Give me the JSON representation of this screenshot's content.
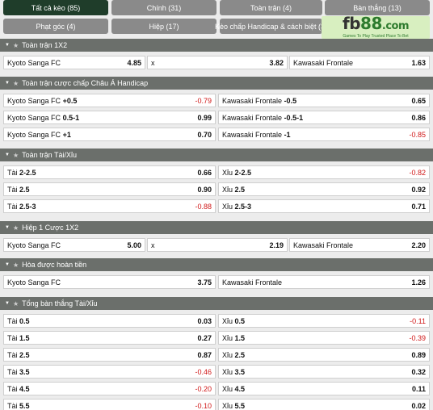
{
  "tabs": [
    {
      "label": "Tất cả kèo (85)",
      "active": true
    },
    {
      "label": "Chính (31)",
      "active": false
    },
    {
      "label": "Toàn trận (4)",
      "active": false
    },
    {
      "label": "Bàn thắng (13)",
      "active": false
    },
    {
      "label": "Phạt góc (4)",
      "active": false
    },
    {
      "label": "Hiệp (17)",
      "active": false
    },
    {
      "label": "Kèo chấp Handicap & cách biệt (3)",
      "active": false
    }
  ],
  "logo": {
    "brand_a": "fb",
    "brand_b": "88",
    "brand_c": ".com",
    "tagline": "Games To Play  Trusted Place To Bet"
  },
  "sections": [
    {
      "title": "Toàn trận 1X2",
      "layout": "three",
      "rows": [
        [
          {
            "name": "Kyoto Sanga FC",
            "odd": "4.85"
          },
          {
            "name": "x",
            "odd": "3.82"
          },
          {
            "name": "Kawasaki Frontale",
            "odd": "1.63"
          }
        ]
      ]
    },
    {
      "title": "Toàn trận cược chấp Châu Á Handicap",
      "layout": "two",
      "rows": [
        [
          {
            "name": "Kyoto Sanga FC",
            "line": "+0.5",
            "odd": "-0.79"
          },
          {
            "name": "Kawasaki Frontale",
            "line": "-0.5",
            "odd": "0.65"
          }
        ],
        [
          {
            "name": "Kyoto Sanga FC",
            "line": "0.5-1",
            "odd": "0.99"
          },
          {
            "name": "Kawasaki Frontale",
            "line": "-0.5-1",
            "odd": "0.86"
          }
        ],
        [
          {
            "name": "Kyoto Sanga FC",
            "line": "+1",
            "odd": "0.70"
          },
          {
            "name": "Kawasaki Frontale",
            "line": "-1",
            "odd": "-0.85"
          }
        ]
      ]
    },
    {
      "title": "Toàn trận Tài/Xỉu",
      "layout": "two",
      "rows": [
        [
          {
            "name": "Tài",
            "line": "2-2.5",
            "odd": "0.66"
          },
          {
            "name": "Xỉu",
            "line": "2-2.5",
            "odd": "-0.82"
          }
        ],
        [
          {
            "name": "Tài",
            "line": "2.5",
            "odd": "0.90"
          },
          {
            "name": "Xỉu",
            "line": "2.5",
            "odd": "0.92"
          }
        ],
        [
          {
            "name": "Tài",
            "line": "2.5-3",
            "odd": "-0.88"
          },
          {
            "name": "Xỉu",
            "line": "2.5-3",
            "odd": "0.71"
          }
        ]
      ]
    },
    {
      "title": "Hiệp 1 Cược 1X2",
      "layout": "three",
      "rows": [
        [
          {
            "name": "Kyoto Sanga FC",
            "odd": "5.00"
          },
          {
            "name": "x",
            "odd": "2.19"
          },
          {
            "name": "Kawasaki Frontale",
            "odd": "2.20"
          }
        ]
      ]
    },
    {
      "title": "Hòa được hoàn tiền",
      "layout": "two",
      "rows": [
        [
          {
            "name": "Kyoto Sanga FC",
            "odd": "3.75"
          },
          {
            "name": "Kawasaki Frontale",
            "odd": "1.26"
          }
        ]
      ]
    },
    {
      "title": "Tổng bàn thắng Tài/Xỉu",
      "layout": "two",
      "rows": [
        [
          {
            "name": "Tài",
            "line": "0.5",
            "odd": "0.03"
          },
          {
            "name": "Xỉu",
            "line": "0.5",
            "odd": "-0.11"
          }
        ],
        [
          {
            "name": "Tài",
            "line": "1.5",
            "odd": "0.27"
          },
          {
            "name": "Xỉu",
            "line": "1.5",
            "odd": "-0.39"
          }
        ],
        [
          {
            "name": "Tài",
            "line": "2.5",
            "odd": "0.87"
          },
          {
            "name": "Xỉu",
            "line": "2.5",
            "odd": "0.89"
          }
        ],
        [
          {
            "name": "Tài",
            "line": "3.5",
            "odd": "-0.46"
          },
          {
            "name": "Xỉu",
            "line": "3.5",
            "odd": "0.32"
          }
        ],
        [
          {
            "name": "Tài",
            "line": "4.5",
            "odd": "-0.20"
          },
          {
            "name": "Xỉu",
            "line": "4.5",
            "odd": "0.11"
          }
        ],
        [
          {
            "name": "Tài",
            "line": "5.5",
            "odd": "-0.10"
          },
          {
            "name": "Xỉu",
            "line": "5.5",
            "odd": "0.02"
          }
        ]
      ]
    }
  ],
  "colors": {
    "header_bg": "#6b6f6b",
    "active_tab": "#1f3d2a",
    "tab_bg": "#8a8a8a",
    "negative": "#d01818"
  },
  "icons": {
    "collapse": "triangle-down-icon",
    "favorite": "star-icon"
  }
}
